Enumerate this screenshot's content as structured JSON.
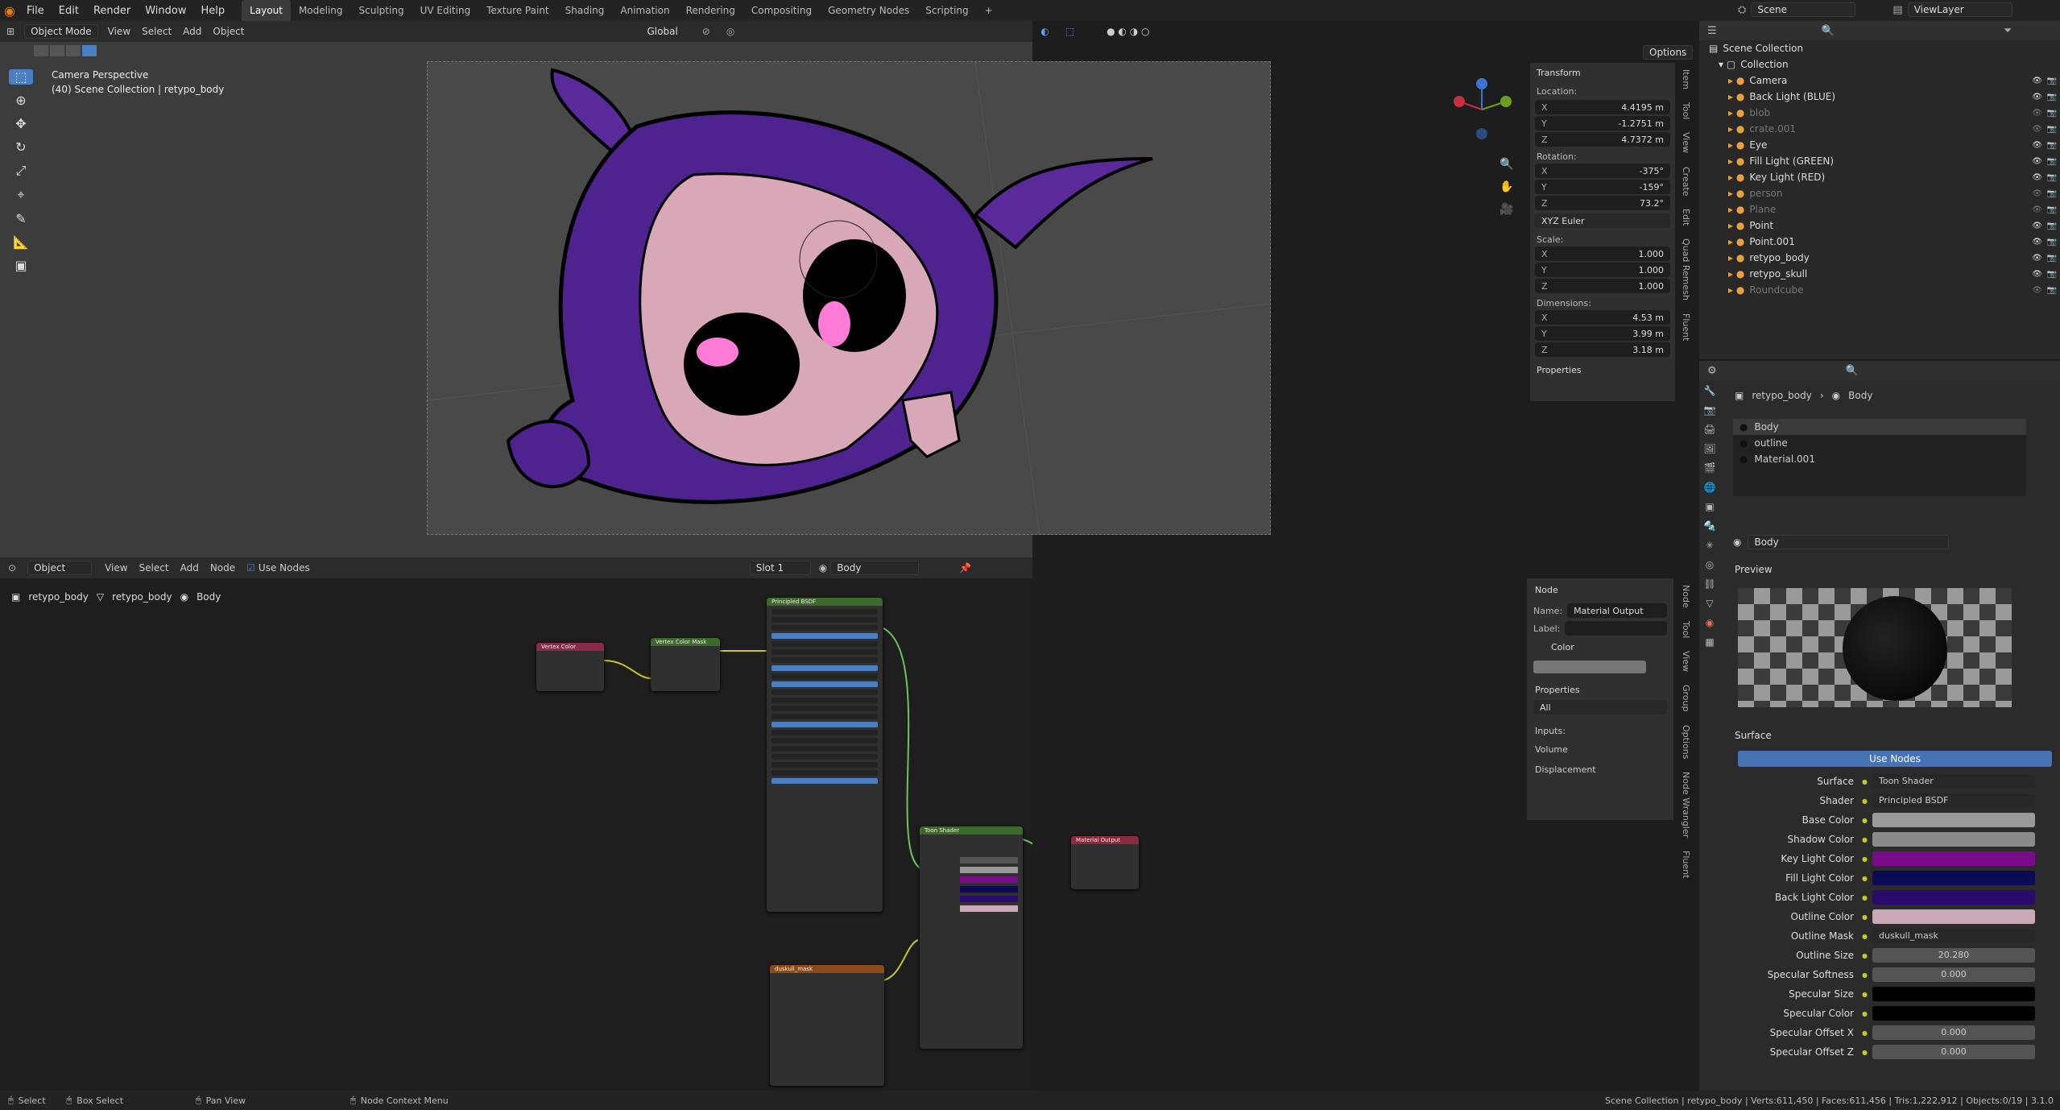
{
  "menu": {
    "file": "File",
    "edit": "Edit",
    "render": "Render",
    "window": "Window",
    "help": "Help"
  },
  "workspaces": [
    "Layout",
    "Modeling",
    "Sculpting",
    "UV Editing",
    "Texture Paint",
    "Shading",
    "Animation",
    "Rendering",
    "Compositing",
    "Geometry Nodes",
    "Scripting",
    "+"
  ],
  "topright": {
    "scene": "Scene",
    "viewlayer": "ViewLayer"
  },
  "viewport": {
    "mode": "Object Mode",
    "view": "View",
    "select": "Select",
    "add": "Add",
    "object": "Object",
    "orientation": "Global",
    "options": "Options",
    "camera_title": "Camera Perspective",
    "camera_sub": "(40) Scene Collection | retypo_body"
  },
  "npanel": {
    "transform": "Transform",
    "location": "Location:",
    "rotation": "Rotation:",
    "scale": "Scale:",
    "dimensions": "Dimensions:",
    "properties": "Properties",
    "euler": "XYZ Euler",
    "loc": [
      {
        "k": "X",
        "v": "4.4195 m"
      },
      {
        "k": "Y",
        "v": "-1.2751 m"
      },
      {
        "k": "Z",
        "v": "4.7372 m"
      }
    ],
    "rot": [
      {
        "k": "X",
        "v": "-375°"
      },
      {
        "k": "Y",
        "v": "-159°"
      },
      {
        "k": "Z",
        "v": "73.2°"
      }
    ],
    "scl": [
      {
        "k": "X",
        "v": "1.000"
      },
      {
        "k": "Y",
        "v": "1.000"
      },
      {
        "k": "Z",
        "v": "1.000"
      }
    ],
    "dim": [
      {
        "k": "X",
        "v": "4.53 m"
      },
      {
        "k": "Y",
        "v": "3.99 m"
      },
      {
        "k": "Z",
        "v": "3.18 m"
      }
    ],
    "tabs": [
      "Item",
      "Tool",
      "View",
      "Create",
      "Edit",
      "Quad Remesh",
      "Fluent"
    ]
  },
  "outliner": {
    "scene_collection": "Scene Collection",
    "collection": "Collection",
    "items": [
      "Camera",
      "Back Light (BLUE)",
      "blob",
      "crate.001",
      "Eye",
      "Fill Light (GREEN)",
      "Key Light (RED)",
      "person",
      "Plane",
      "Point",
      "Point.001",
      "retypo_body",
      "retypo_skull",
      "Roundcube"
    ]
  },
  "props": {
    "crumb_obj": "retypo_body",
    "crumb_mat": "Body",
    "slots": [
      "Body",
      "outline",
      "Material.001"
    ],
    "material": "Body",
    "preview": "Preview",
    "surface": "Surface",
    "use_nodes": "Use Nodes",
    "fields": [
      {
        "k": "Surface",
        "v": "Toon Shader"
      },
      {
        "k": "Shader",
        "v": "Principled BSDF"
      },
      {
        "k": "Base Color",
        "v": ""
      },
      {
        "k": "Shadow Color",
        "v": ""
      },
      {
        "k": "Key Light Color",
        "v": ""
      },
      {
        "k": "Fill Light Color",
        "v": ""
      },
      {
        "k": "Back Light Color",
        "v": ""
      },
      {
        "k": "Outline Color",
        "v": ""
      },
      {
        "k": "Outline Mask",
        "v": "duskull_mask"
      },
      {
        "k": "Outline Size",
        "v": "20.280"
      },
      {
        "k": "Specular Softness",
        "v": "0.000"
      },
      {
        "k": "Specular Size",
        "v": ""
      },
      {
        "k": "Specular Color",
        "v": ""
      },
      {
        "k": "Specular Offset X",
        "v": "0.000"
      },
      {
        "k": "Specular Offset Z",
        "v": "0.000"
      }
    ],
    "colors": {
      "base": "#9a9a9a",
      "shadow": "#8a8a8a",
      "key": "#7a0a8a",
      "fill": "#0b0b55",
      "back": "#2a0a6a",
      "outline": "#c9a8b8",
      "spec_size": "#000000",
      "spec_color": "#000000"
    }
  },
  "nodeeditor": {
    "object": "Object",
    "view": "View",
    "select": "Select",
    "add": "Add",
    "node": "Node",
    "use_nodes": "Use Nodes",
    "slot": "Slot 1",
    "material": "Body",
    "crumb1": "retypo_body",
    "crumb2": "retypo_body",
    "crumb3": "Body",
    "side": {
      "node": "Node",
      "name_label": "Name:",
      "name_value": "Material Output",
      "label_label": "Label:",
      "color": "Color",
      "properties": "Properties",
      "all": "All",
      "inputs": "Inputs:",
      "volume": "Volume",
      "displacement": "Displacement"
    },
    "tabs": [
      "Node",
      "Tool",
      "View",
      "Group",
      "Options",
      "Node Wrangler",
      "Fluent"
    ],
    "nodes": {
      "vc": "Vertex Color",
      "vcm": "Vertex Color Mask",
      "bsdf": "Principled BSDF",
      "toon": "Toon Shader",
      "out": "Material Output",
      "mask": "duskull_mask"
    }
  },
  "status": {
    "select": "Select",
    "box": "Box Select",
    "pan": "Pan View",
    "ctx": "Node Context Menu",
    "info": "Scene Collection | retypo_body | Verts:611,450 | Faces:611,456 | Tris:1,222,912 | Objects:0/19 | 3.1.0"
  }
}
